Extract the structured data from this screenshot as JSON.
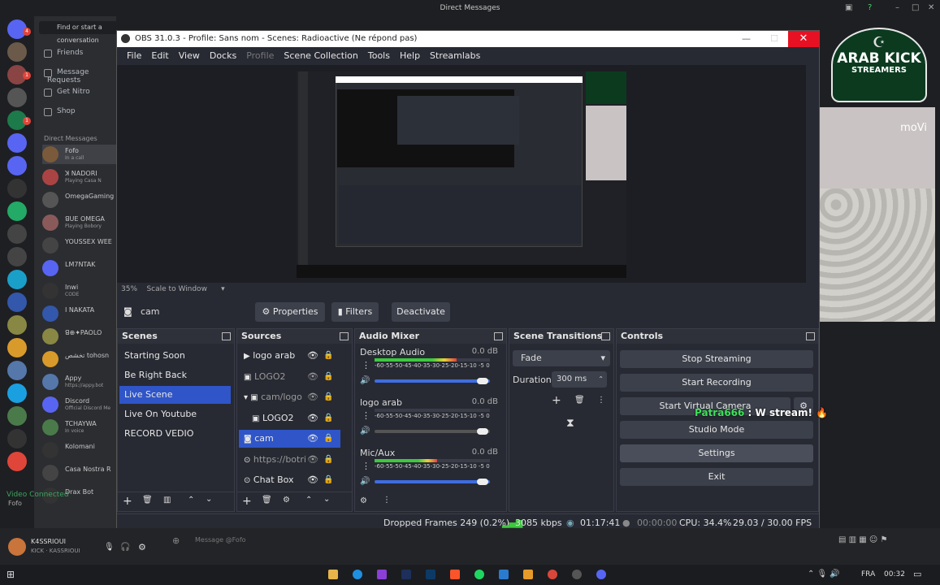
{
  "desktop_title": "Direct Messages",
  "discord": {
    "find_placeholder": "Find or start a conversation",
    "nav": [
      "Friends",
      "Message Requests",
      "Get Nitro",
      "Shop"
    ],
    "dm_header": "Direct Messages",
    "dms": [
      {
        "name": "Fofo",
        "sub": "In a call"
      },
      {
        "name": "ꓘ NADORI",
        "sub": "Playing Casa N"
      },
      {
        "name": "OmegaGaming",
        "sub": ""
      },
      {
        "name": "ꓭꓴꓰ OMEGA",
        "sub": "Playing Bobory"
      },
      {
        "name": "YOUSSEX WEE",
        "sub": ""
      },
      {
        "name": "LM7NTAK",
        "sub": ""
      },
      {
        "name": "Inwi",
        "sub": "CODE"
      },
      {
        "name": "I NAKATA",
        "sub": ""
      },
      {
        "name": "ꓭ⊕✦PAOLO",
        "sub": ""
      },
      {
        "name": "تخشص tohosn",
        "sub": ""
      },
      {
        "name": "Appy",
        "sub": "https://appy.bot"
      },
      {
        "name": "Discord",
        "sub": "Official Discord Me"
      },
      {
        "name": "TCHAYWA",
        "sub": "In voice"
      },
      {
        "name": "Kolomani",
        "sub": ""
      },
      {
        "name": "Casa Nostra R",
        "sub": ""
      },
      {
        "name": "Drax Bot",
        "sub": ""
      }
    ],
    "video_connected": "Video Connected",
    "video_sub": "Fofo",
    "user_name": "K4SSRIOUI",
    "user_sub": "KICK · KASSRIOUI",
    "message_placeholder": "Message @Fofo"
  },
  "obs": {
    "title": "OBS 31.0.3 - Profile: Sans nom - Scenes: Radioactive (Ne répond pas)",
    "menu": [
      "File",
      "Edit",
      "View",
      "Docks",
      "Profile",
      "Scene Collection",
      "Tools",
      "Help",
      "Streamlabs"
    ],
    "scale_pct": "35%",
    "scale_mode": "Scale to Window",
    "source_name": "cam",
    "ctx_buttons": {
      "properties": "Properties",
      "filters": "Filters",
      "deactivate": "Deactivate"
    },
    "docks": {
      "scenes": "Scenes",
      "sources": "Sources",
      "mixer": "Audio Mixer",
      "transitions": "Scene Transitions",
      "controls": "Controls"
    },
    "scenes": [
      "Starting Soon",
      "Be Right Back",
      "Live Scene",
      "Live On Youtube",
      "RECORD VEDIO"
    ],
    "selected_scene": "Live Scene",
    "sources": [
      "logo arab",
      "LOGO2",
      "cam/logo",
      "LOGO2",
      "cam",
      "https://botri",
      "Chat Box"
    ],
    "mixer": [
      {
        "name": "Desktop Audio",
        "db": "0.0 dB",
        "level": 0.72
      },
      {
        "name": "logo arab",
        "db": "0.0 dB",
        "level": 0.0
      },
      {
        "name": "Mic/Aux",
        "db": "0.0 dB",
        "level": 0.55
      }
    ],
    "meter_ticks": "-60-55-50-45-40-35-30-25-20-15-10 -5 0",
    "transition": "Fade",
    "duration_label": "Duration",
    "duration": "300 ms",
    "controls": [
      "Stop Streaming",
      "Start Recording",
      "Start Virtual Camera",
      "Studio Mode",
      "Settings",
      "Exit"
    ],
    "status": {
      "dropped": "Dropped Frames 249 (0.2%)",
      "kbps": "3085 kbps",
      "live": "01:17:41",
      "rec": "00:00:00",
      "cpu": "CPU: 34.4%",
      "fps": "29.03 / 30.00 FPS"
    }
  },
  "overlay": {
    "chat_user": "Patra666",
    "chat_msg": " : W stream! 🔥",
    "logo_line1": "ARAB KICK",
    "logo_line2": "STREAMERS",
    "cam_text": "moVi"
  },
  "taskbar": {
    "lang": "FRA",
    "time": "00:32"
  }
}
